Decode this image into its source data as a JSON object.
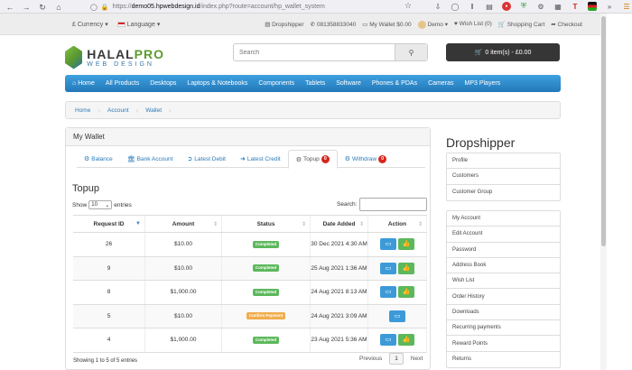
{
  "browser": {
    "url_prefix": "https://",
    "url_host": "demo05.hpwebdesign.id",
    "url_path": "/index.php?route=account/hp_wallet_system"
  },
  "topbar": {
    "currency": "£ Currency",
    "language": "Language",
    "links": [
      {
        "name": "dropshipper",
        "label": "Dropshipper",
        "icon": "monitor-icon"
      },
      {
        "name": "phone",
        "label": "081358833040",
        "icon": "phone-icon"
      },
      {
        "name": "my-wallet",
        "label": "My Wallet $0.00",
        "icon": "wallet-icon"
      },
      {
        "name": "account",
        "label": "Demo",
        "icon": "avatar"
      },
      {
        "name": "wish-list",
        "label": "Wish List (0)",
        "icon": "heart-icon"
      },
      {
        "name": "shopping-cart",
        "label": "Shopping Cart",
        "icon": "cart-icon"
      },
      {
        "name": "checkout",
        "label": "Checkout",
        "icon": "share-icon"
      }
    ]
  },
  "header": {
    "logo_main": "HALAL",
    "logo_accent": "PRO",
    "logo_sub": "WEB DESIGN",
    "search_placeholder": "Search",
    "cart_label": "0 item(s) - £0.00"
  },
  "nav": [
    "Home",
    "All Products",
    "Desktops",
    "Laptops & Notebooks",
    "Components",
    "Tablets",
    "Software",
    "Phones & PDAs",
    "Cameras",
    "MP3 Players"
  ],
  "breadcrumb": [
    "Home",
    "Account",
    "Wallet"
  ],
  "wallet": {
    "title": "My Wallet",
    "tabs": [
      {
        "label": "Balance",
        "icon": "gear-icon",
        "active": false,
        "badge": ""
      },
      {
        "label": "Bank Account",
        "icon": "bank-icon",
        "active": false,
        "badge": ""
      },
      {
        "label": "Latest Debit",
        "icon": "sign-out-icon",
        "active": false,
        "badge": ""
      },
      {
        "label": "Latest Credit",
        "icon": "sign-in-icon",
        "active": false,
        "badge": ""
      },
      {
        "label": "Topup",
        "icon": "gears-icon",
        "active": true,
        "badge": "0"
      },
      {
        "label": "Withdraw",
        "icon": "gears-icon",
        "active": false,
        "badge": "0"
      }
    ],
    "section_title": "Topup",
    "show_label": "Show",
    "entries_value": "10",
    "entries_label": "entries",
    "search_label": "Search:",
    "columns": [
      "Request ID",
      "Amount",
      "Status",
      "Date Added",
      "Action"
    ],
    "rows": [
      {
        "id": "26",
        "amount": "$10.00",
        "status": "Completed",
        "status_type": "completed",
        "date": "30 Dec 2021 4:30 AM",
        "actions": [
          "edit",
          "approve"
        ]
      },
      {
        "id": "9",
        "amount": "$10.00",
        "status": "Completed",
        "status_type": "completed",
        "date": "25 Aug 2021 1:36 AM",
        "actions": [
          "edit",
          "approve"
        ]
      },
      {
        "id": "8",
        "amount": "$1,000.00",
        "status": "Completed",
        "status_type": "completed",
        "date": "24 Aug 2021 8:13 AM",
        "actions": [
          "edit",
          "approve"
        ]
      },
      {
        "id": "5",
        "amount": "$10.00",
        "status": "Confirm Payment",
        "status_type": "confirm",
        "date": "24 Aug 2021 3:09 AM",
        "actions": [
          "edit"
        ]
      },
      {
        "id": "4",
        "amount": "$1,000.00",
        "status": "Completed",
        "status_type": "completed",
        "date": "23 Aug 2021 5:36 AM",
        "actions": [
          "edit",
          "approve"
        ]
      }
    ],
    "showing": "Showing 1 to 5 of 5 entries",
    "pager": {
      "previous": "Previous",
      "page": "1",
      "next": "Next"
    }
  },
  "sidebar": {
    "title": "Dropshipper",
    "group1": [
      "Profile",
      "Customers",
      "Customer Group"
    ],
    "group2": [
      "My Account",
      "Edit Account",
      "Password",
      "Address Book",
      "Wish List",
      "Order History",
      "Downloads",
      "Recurring payments",
      "Reward Points",
      "Returns"
    ]
  },
  "colors": {
    "nav_bg": "#2f8bd0",
    "link": "#2a7ab8",
    "completed": "#5cb85c",
    "confirm": "#f0ad4e",
    "badge": "#d9251d"
  }
}
